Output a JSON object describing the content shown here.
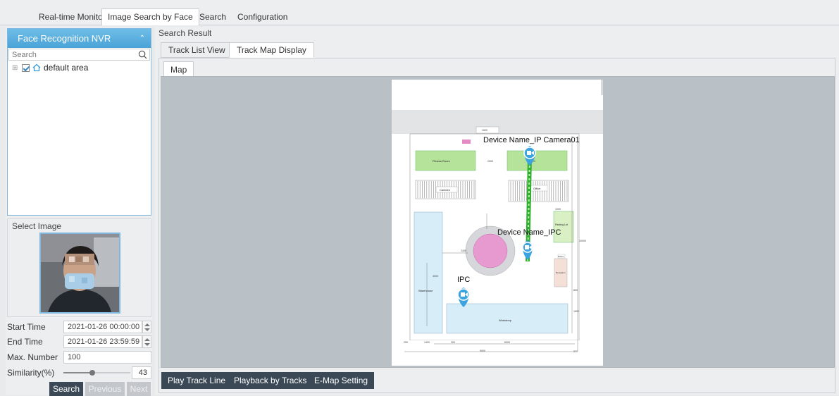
{
  "top_tabs": [
    "Real-time Monitoring",
    "Image Search by Face",
    "Search",
    "Configuration"
  ],
  "tree": {
    "title": "Face Recognition NVR",
    "search_placeholder": "Search",
    "root_item": "default area"
  },
  "select_image": {
    "label": "Select Image"
  },
  "form": {
    "start_time_label": "Start Time",
    "start_time_value": "2021-01-26 00:00:00",
    "end_time_label": "End Time",
    "end_time_value": "2021-01-26 23:59:59",
    "max_number_label": "Max. Number",
    "max_number_value": "100",
    "similarity_label": "Similarity(%)",
    "similarity_value": "43",
    "similarity_fraction": 0.43
  },
  "buttons": {
    "search": "Search",
    "previous": "Previous",
    "next": "Next"
  },
  "main": {
    "search_result_label": "Search Result",
    "tabs": [
      "Track List View",
      "Track Map Display"
    ],
    "map_tab": "Map"
  },
  "map": {
    "camera_labels": [
      "Device Name_IP Camera01",
      "Device Name_IPC",
      "IPC"
    ],
    "room_labels": [
      "Fitness Room",
      "Canteen",
      "Office",
      "Parking Lot",
      "Warehouse",
      "Workshop",
      "Reception",
      "Kitchen"
    ],
    "dimension_labels": [
      "1500",
      "2000",
      "2000",
      "2400",
      "1000",
      "1400",
      "200",
      "6000",
      "9000",
      "200",
      "200",
      "1600",
      "4000",
      "800",
      "10000"
    ],
    "track_color": "#2fae2f",
    "camera_color": "#3ba3df"
  },
  "map_buttons": [
    "Play Track Line",
    "Playback by Tracks",
    "E-Map Setting"
  ]
}
